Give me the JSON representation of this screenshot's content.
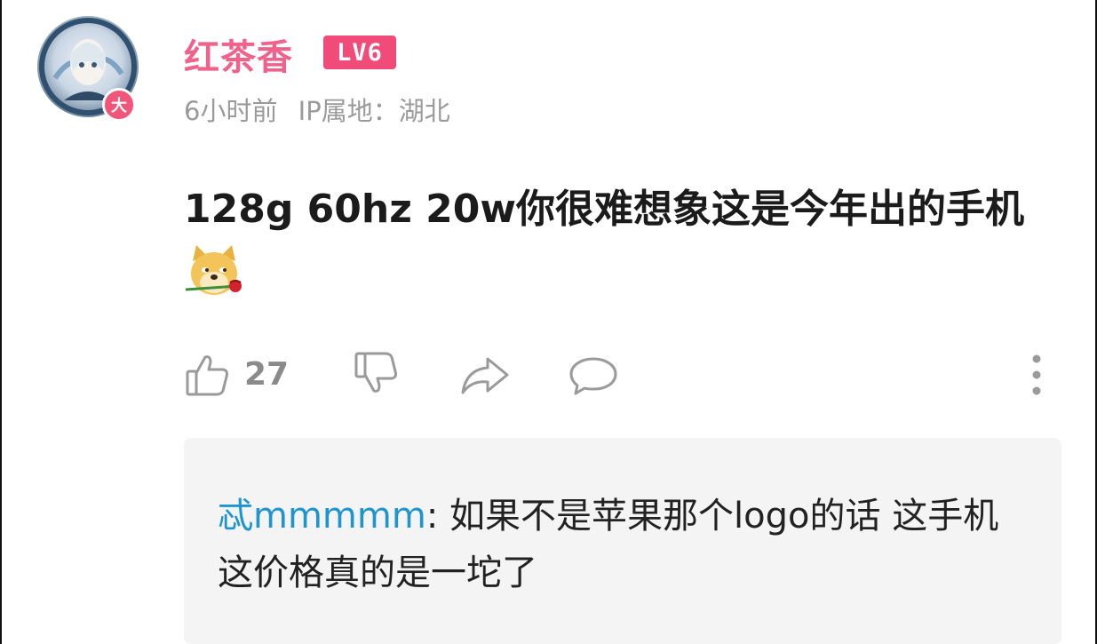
{
  "comment": {
    "username": "红茶香",
    "level": "LV6",
    "avatar_badge": "大",
    "time": "6小时前",
    "ip_location": "IP属地：湖北",
    "text": "128g 60hz 20w你很难想象这是今年出的手机",
    "emoji": "doge-rose-emoji"
  },
  "actions": {
    "like_count": "27",
    "icons": [
      "thumbs-up-icon",
      "thumbs-down-icon",
      "share-icon",
      "comment-icon",
      "more-vertical-icon"
    ]
  },
  "reply": {
    "username": "忒mmmmm",
    "separator": ": ",
    "text": "如果不是苹果那个logo的话  这手机这价格真的是一坨了"
  },
  "colors": {
    "username": "#f0628b",
    "level_badge": "#f14b7a",
    "reply_user": "#1e95cf",
    "reply_bg": "#f4f4f4",
    "meta": "#9a9a9a"
  }
}
